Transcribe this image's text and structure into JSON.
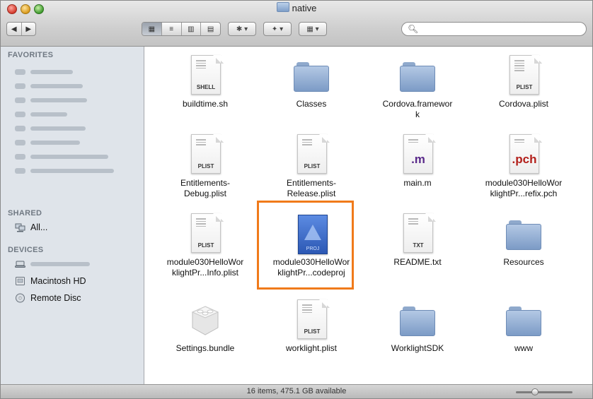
{
  "window": {
    "title": "native"
  },
  "toolbar": {
    "back_label": "◀",
    "forward_label": "▶",
    "view_icon_label": "▦",
    "view_list_label": "≡",
    "view_column_label": "▥",
    "view_coverflow_label": "▤",
    "action_label": "✱ ▾",
    "dropbox_label": "✦ ▾",
    "arrange_label": "▦ ▾",
    "search_placeholder": ""
  },
  "sidebar": {
    "favorites_header": "FAVORITES",
    "shared_header": "SHARED",
    "shared_items": [
      {
        "label": "All..."
      }
    ],
    "devices_header": "DEVICES",
    "device_items": [
      {
        "label": "Macintosh HD"
      },
      {
        "label": "Remote Disc"
      }
    ]
  },
  "files": [
    {
      "name": "buildtime.sh",
      "kind": "doc",
      "tag": "SHELL"
    },
    {
      "name": "Classes",
      "kind": "folder"
    },
    {
      "name": "Cordova.framework",
      "kind": "folder"
    },
    {
      "name": "Cordova.plist",
      "kind": "doc",
      "tag": "PLIST"
    },
    {
      "name": "Entitlements-Debug.plist",
      "kind": "doc",
      "tag": "PLIST"
    },
    {
      "name": "Entitlements-Release.plist",
      "kind": "doc",
      "tag": "PLIST"
    },
    {
      "name": "main.m",
      "kind": "ext",
      "ext": ".m",
      "ext_color": "#5a2a8a"
    },
    {
      "name": "module030HelloWorklightPr...refix.pch",
      "kind": "ext",
      "ext": ".pch",
      "ext_color": "#b3201b"
    },
    {
      "name": "module030HelloWorklightPr...Info.plist",
      "kind": "doc",
      "tag": "PLIST"
    },
    {
      "name": "module030HelloWorklightPr...codeproj",
      "kind": "xcodeproj",
      "tag": "PROJ"
    },
    {
      "name": "README.txt",
      "kind": "doc",
      "tag": "TXT"
    },
    {
      "name": "Resources",
      "kind": "folder"
    },
    {
      "name": "Settings.bundle",
      "kind": "bundle"
    },
    {
      "name": "worklight.plist",
      "kind": "doc",
      "tag": "PLIST"
    },
    {
      "name": "WorklightSDK",
      "kind": "folder"
    },
    {
      "name": "www",
      "kind": "folder"
    }
  ],
  "status": {
    "text": "16 items, 475.1 GB available"
  },
  "colors": {
    "highlight": "#f07a1a",
    "sidebar_bg": "#dfe4ea"
  }
}
